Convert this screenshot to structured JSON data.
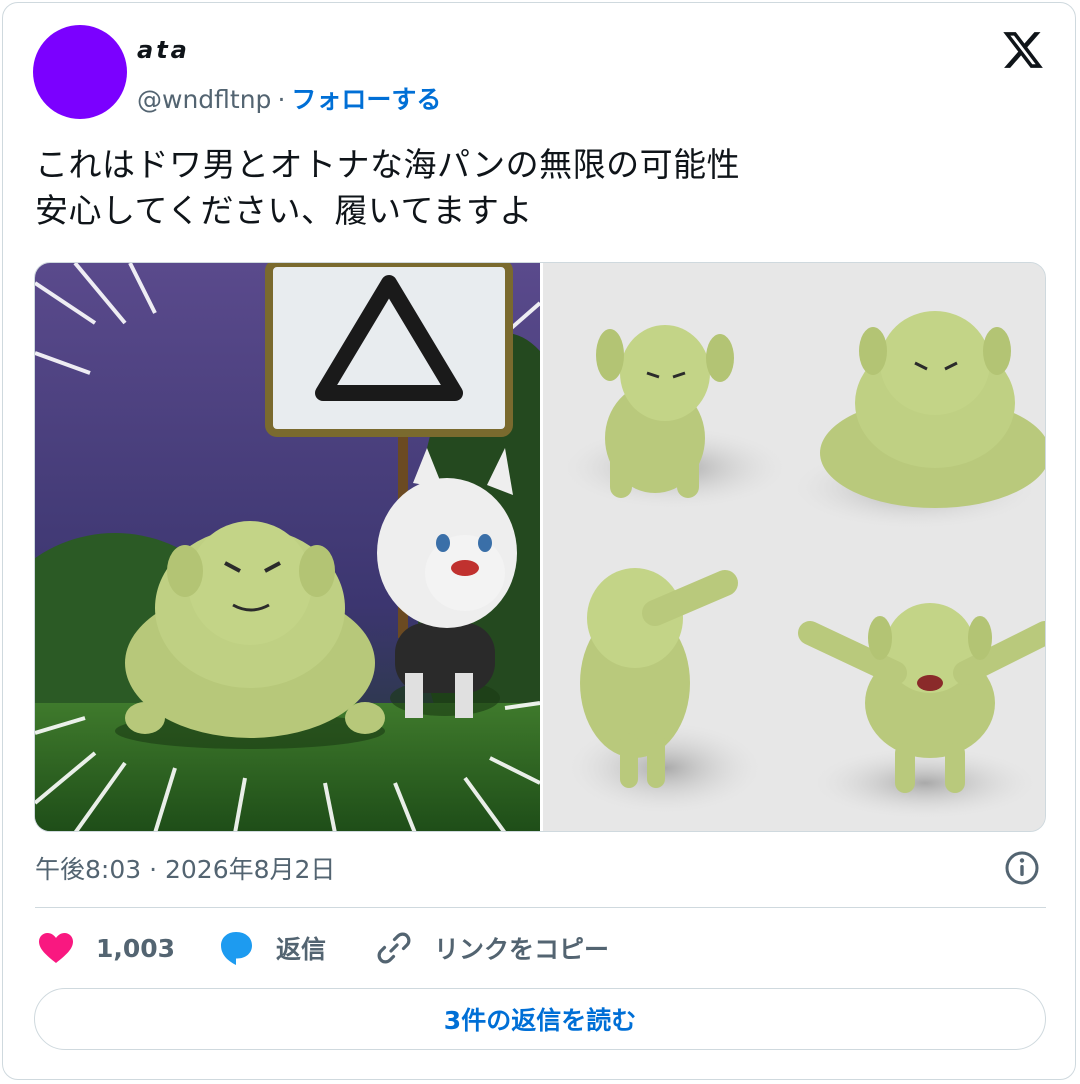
{
  "author": {
    "display_name": "ata",
    "handle": "@wndfltnp",
    "separator": "·",
    "follow_label": "フォローする",
    "avatar_color": "#7b00ff"
  },
  "tweet": {
    "text": "これはドワ男とオトナな海パンの無限の可能性\n安心してください、履いてますよ",
    "timestamp": "午後8:03 · 2026年8月2日"
  },
  "actions": {
    "like_count": "1,003",
    "reply_label": "返信",
    "copy_link_label": "リンクをコピー"
  },
  "read_replies_label": "3件の返信を読む",
  "icons": {
    "logo": "x-logo-icon",
    "info": "info-icon",
    "like": "heart-icon",
    "reply": "speech-bubble-icon",
    "copy": "link-icon"
  },
  "colors": {
    "accent": "#006fd6",
    "like": "#f91880",
    "reply_icon": "#1d9bf0",
    "muted": "#536471",
    "border": "#cfd9de"
  }
}
